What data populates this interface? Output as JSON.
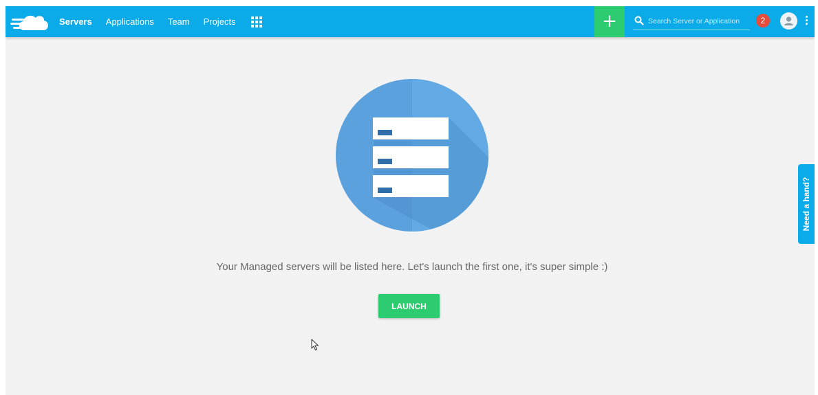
{
  "nav": {
    "items": [
      {
        "label": "Servers",
        "active": true
      },
      {
        "label": "Applications",
        "active": false
      },
      {
        "label": "Team",
        "active": false
      },
      {
        "label": "Projects",
        "active": false
      }
    ],
    "apps_icon": "grid-icon"
  },
  "toolbar": {
    "add_label": "+",
    "search_placeholder": "Search Server or Application",
    "notification_count": "2",
    "avatar_icon": "user-icon",
    "menu_icon": "kebab-menu-icon"
  },
  "main": {
    "empty_message": "Your Managed servers will be listed here. Let's launch the first one, it's super simple :)",
    "launch_label": "LAUNCH"
  },
  "help": {
    "label": "Need a hand?"
  },
  "colors": {
    "brand": "#0aabe8",
    "accent": "#2ecc71",
    "badge": "#e74c3c",
    "background": "#f2f2f2"
  }
}
